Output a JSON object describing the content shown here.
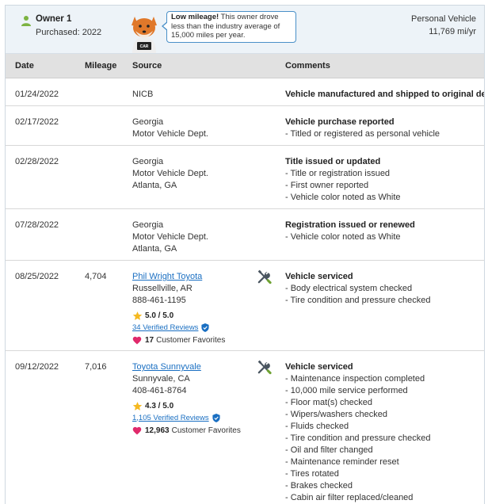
{
  "owner": {
    "name": "Owner 1",
    "purchased": "Purchased: 2022",
    "tip_bold": "Low mileage!",
    "tip_text": " This owner drove less than the industry average of 15,000 miles per year.",
    "vehicle_type": "Personal Vehicle",
    "miles_per_year": "11,769 mi/yr"
  },
  "table": {
    "headers": {
      "date": "Date",
      "mileage": "Mileage",
      "source": "Source",
      "comments": "Comments"
    }
  },
  "records": [
    {
      "date": "01/24/2022",
      "mileage": "",
      "source": [
        "NICB"
      ],
      "title": "Vehicle manufactured and shipped to original dealer",
      "details": []
    },
    {
      "date": "02/17/2022",
      "mileage": "",
      "source": [
        "Georgia",
        "Motor Vehicle Dept."
      ],
      "title": "Vehicle purchase reported",
      "details": [
        "- Titled or registered as personal vehicle"
      ]
    },
    {
      "date": "02/28/2022",
      "mileage": "",
      "source": [
        "Georgia",
        "Motor Vehicle Dept.",
        "Atlanta, GA"
      ],
      "title": "Title issued or updated",
      "details": [
        "- Title or registration issued",
        "- First owner reported",
        "- Vehicle color noted as White"
      ]
    },
    {
      "date": "07/28/2022",
      "mileage": "",
      "source": [
        "Georgia",
        "Motor Vehicle Dept.",
        "Atlanta, GA"
      ],
      "title": "Registration issued or renewed",
      "details": [
        "- Vehicle color noted as White"
      ]
    },
    {
      "date": "08/25/2022",
      "mileage": "4,704",
      "dealer": {
        "name": "Phil Wright Toyota",
        "city": "Russellville, AR",
        "phone": "888-461-1195",
        "rating": "5.0 / 5.0",
        "reviews": "34 Verified Reviews",
        "favorites_count": "17",
        "favorites_label": "Customer Favorites"
      },
      "title": "Vehicle serviced",
      "details": [
        "- Body electrical system checked",
        "- Tire condition and pressure checked"
      ]
    },
    {
      "date": "09/12/2022",
      "mileage": "7,016",
      "dealer": {
        "name": "Toyota Sunnyvale",
        "city": "Sunnyvale, CA",
        "phone": "408-461-8764",
        "rating": "4.3 / 5.0",
        "reviews": "1,105 Verified Reviews",
        "favorites_count": "12,963",
        "favorites_label": "Customer Favorites"
      },
      "title": "Vehicle serviced",
      "details": [
        "- Maintenance inspection completed",
        "- 10,000 mile service performed",
        "- Floor mat(s) checked",
        "- Wipers/washers checked",
        "- Fluids checked",
        "- Tire condition and pressure checked",
        "- Oil and filter changed",
        "- Maintenance reminder reset",
        "- Tires rotated",
        "- Brakes checked",
        "- Cabin air filter replaced/cleaned"
      ]
    }
  ],
  "colors": {
    "accent_link": "#1a6fc2",
    "header_bg": "#edf3f8",
    "table_head_bg": "#e1e1e1",
    "star": "#f5b921",
    "heart": "#e0296b",
    "person_icon": "#7cb342"
  }
}
